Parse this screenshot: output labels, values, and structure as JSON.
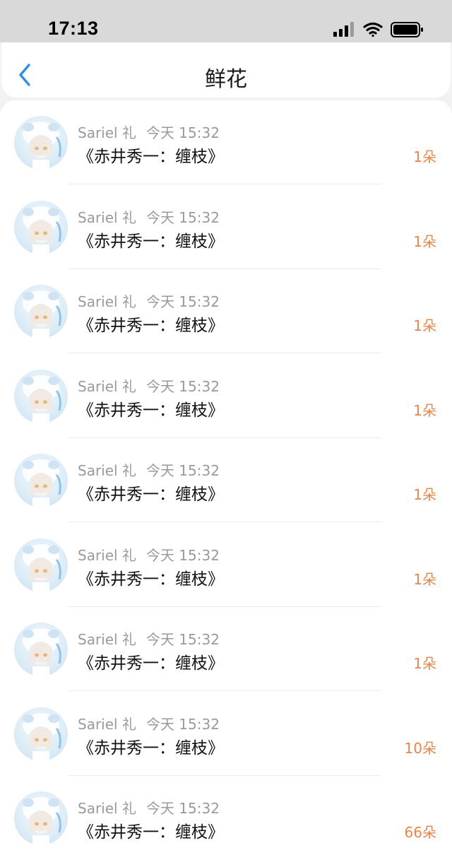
{
  "status": {
    "time": "17:13"
  },
  "header": {
    "title": "鲜花"
  },
  "items": [
    {
      "user": "Sariel 礼",
      "time": "今天 15:32",
      "gift": "《赤井秀一：缠枝》",
      "count": "1朵"
    },
    {
      "user": "Sariel 礼",
      "time": "今天 15:32",
      "gift": "《赤井秀一：缠枝》",
      "count": "1朵"
    },
    {
      "user": "Sariel 礼",
      "time": "今天 15:32",
      "gift": "《赤井秀一：缠枝》",
      "count": "1朵"
    },
    {
      "user": "Sariel 礼",
      "time": "今天 15:32",
      "gift": "《赤井秀一：缠枝》",
      "count": "1朵"
    },
    {
      "user": "Sariel 礼",
      "time": "今天 15:32",
      "gift": "《赤井秀一：缠枝》",
      "count": "1朵"
    },
    {
      "user": "Sariel 礼",
      "time": "今天 15:32",
      "gift": "《赤井秀一：缠枝》",
      "count": "1朵"
    },
    {
      "user": "Sariel 礼",
      "time": "今天 15:32",
      "gift": "《赤井秀一：缠枝》",
      "count": "1朵"
    },
    {
      "user": "Sariel 礼",
      "time": "今天 15:32",
      "gift": "《赤井秀一：缠枝》",
      "count": "10朵"
    },
    {
      "user": "Sariel 礼",
      "time": "今天 15:32",
      "gift": "《赤井秀一：缠枝》",
      "count": "66朵"
    }
  ],
  "icons": {
    "back": "chevron-left-icon",
    "signal": "cellular-signal-icon",
    "wifi": "wifi-icon",
    "battery": "battery-icon"
  },
  "colors": {
    "accent": "#2f8fe6",
    "count": "#e8864a"
  }
}
